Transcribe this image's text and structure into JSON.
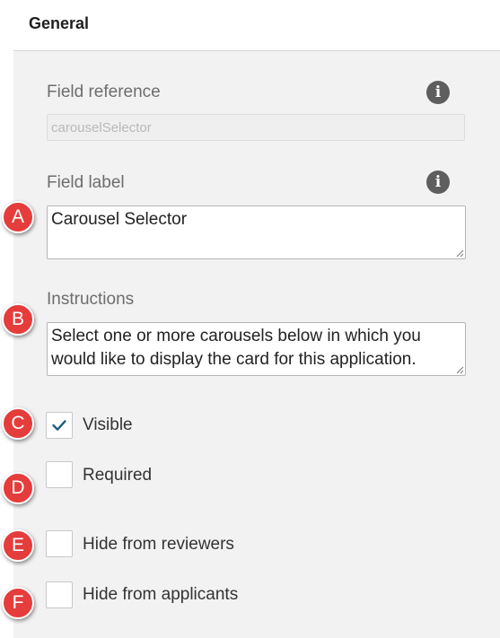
{
  "header": {
    "title": "General"
  },
  "field_reference": {
    "label": "Field reference",
    "value": "carouselSelector"
  },
  "field_label": {
    "label": "Field label",
    "value": "Carousel Selector"
  },
  "instructions": {
    "label": "Instructions",
    "line1": "Select one or more carousels below in which you",
    "line2": "would like to display the card for this application."
  },
  "checkboxes": [
    {
      "label": "Visible",
      "checked": true
    },
    {
      "label": "Required",
      "checked": false
    },
    {
      "label": "Hide from reviewers",
      "checked": false
    },
    {
      "label": "Hide from applicants",
      "checked": false
    }
  ],
  "callouts": [
    "A",
    "B",
    "C",
    "D",
    "E",
    "F"
  ],
  "icons": {
    "info": "i",
    "check": "check-icon",
    "resize": "resize-handle-icon"
  },
  "colors": {
    "callout": "#e53c3c",
    "checkmark": "#1b5e7a",
    "panel": "#f2f2f2"
  }
}
